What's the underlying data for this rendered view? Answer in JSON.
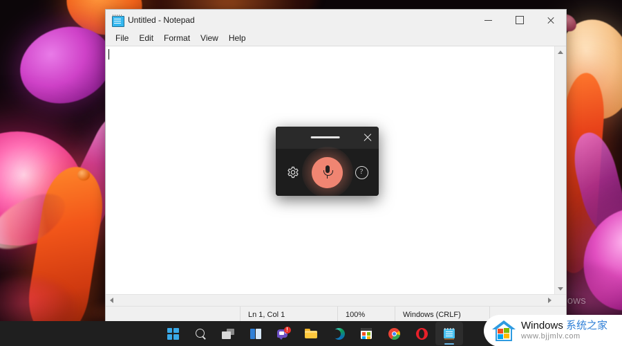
{
  "desktop": {
    "activation_watermark": "Windows",
    "activation_sub": ""
  },
  "notepad": {
    "title": "Untitled - Notepad",
    "icon": "notepad-icon",
    "menus": [
      "File",
      "Edit",
      "Format",
      "View",
      "Help"
    ],
    "window_controls": {
      "minimize": "minimize-icon",
      "maximize": "maximize-icon",
      "close": "close-icon"
    },
    "document_text": "",
    "status": {
      "empty": "",
      "position": "Ln 1, Col 1",
      "zoom": "100%",
      "line_ending": "Windows (CRLF)",
      "encoding": ""
    },
    "scrollbar": {
      "up": "chevron-up-icon",
      "down": "chevron-down-icon",
      "left": "chevron-left-icon",
      "right": "chevron-right-icon"
    }
  },
  "voice_panel": {
    "drag_handle": "drag-handle",
    "close": "close-icon",
    "settings": "gear-icon",
    "mic": "microphone-icon",
    "help": "?",
    "mic_color": "#f08572",
    "panel_bg": "#1d1d1d",
    "header_bg": "#2a2a2a"
  },
  "taskbar": {
    "items": [
      {
        "name": "start",
        "label": "Start"
      },
      {
        "name": "search",
        "label": "Search"
      },
      {
        "name": "task-view",
        "label": "Task View"
      },
      {
        "name": "widgets",
        "label": "Widgets"
      },
      {
        "name": "chat",
        "label": "Chat",
        "badge": "!"
      },
      {
        "name": "file-explorer",
        "label": "File Explorer"
      },
      {
        "name": "edge",
        "label": "Microsoft Edge"
      },
      {
        "name": "store",
        "label": "Microsoft Store"
      },
      {
        "name": "chrome",
        "label": "Google Chrome"
      },
      {
        "name": "opera",
        "label": "Opera"
      },
      {
        "name": "notepad",
        "label": "Notepad",
        "active": true
      }
    ]
  },
  "site_watermark": {
    "brand_en": "Windows ",
    "brand_cn": "系统之家",
    "url": "www.bjjmlv.com"
  }
}
